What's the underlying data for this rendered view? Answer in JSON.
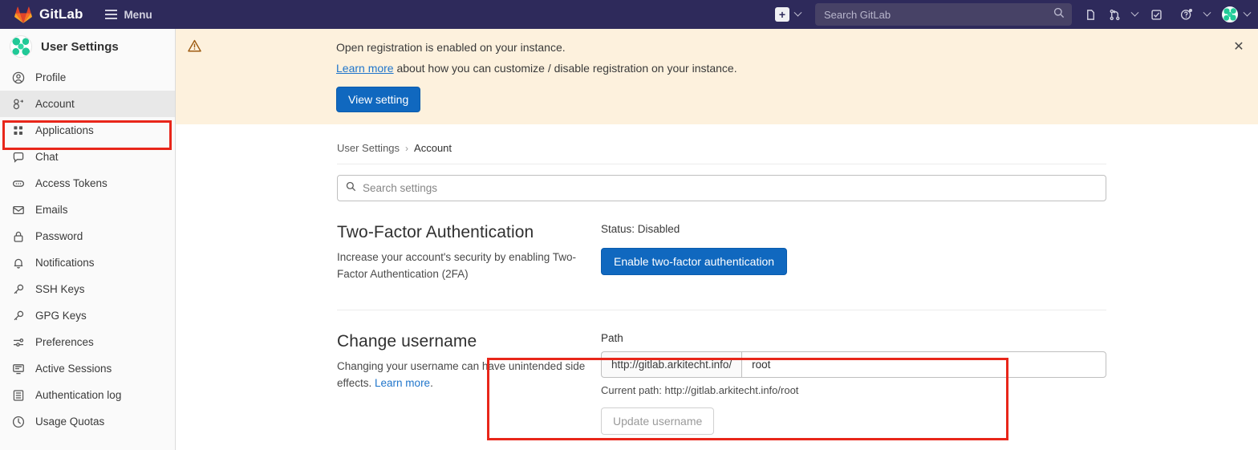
{
  "topbar": {
    "brand": "GitLab",
    "menu_label": "Menu",
    "plus_icon": "plus-icon",
    "plus_chevron_icon": "chevron-down-icon",
    "search_placeholder": "Search GitLab",
    "search_icon": "search-icon",
    "issues_icon": "issues-icon",
    "merge_requests_icon": "merge-requests-icon",
    "merge_requests_chevron_icon": "chevron-down-icon",
    "todos_icon": "todos-checkbox-icon",
    "help_icon": "help-question-icon",
    "help_chevron_icon": "chevron-down-icon",
    "avatar_icon": "user-avatar",
    "avatar_chevron_icon": "chevron-down-icon"
  },
  "sidebar": {
    "title": "User Settings",
    "avatar_icon": "user-avatar",
    "items": [
      {
        "label": "Profile",
        "icon": "user-circle-icon",
        "active": false
      },
      {
        "label": "Account",
        "icon": "account-key-icon",
        "active": true
      },
      {
        "label": "Applications",
        "icon": "applications-icon",
        "active": false
      },
      {
        "label": "Chat",
        "icon": "chat-bubble-icon",
        "active": false
      },
      {
        "label": "Access Tokens",
        "icon": "token-icon",
        "active": false
      },
      {
        "label": "Emails",
        "icon": "envelope-icon",
        "active": false
      },
      {
        "label": "Password",
        "icon": "lock-icon",
        "active": false
      },
      {
        "label": "Notifications",
        "icon": "bell-icon",
        "active": false
      },
      {
        "label": "SSH Keys",
        "icon": "key-icon",
        "active": false
      },
      {
        "label": "GPG Keys",
        "icon": "key-icon",
        "active": false
      },
      {
        "label": "Preferences",
        "icon": "sliders-icon",
        "active": false
      },
      {
        "label": "Active Sessions",
        "icon": "monitor-icon",
        "active": false
      },
      {
        "label": "Authentication log",
        "icon": "log-list-icon",
        "active": false
      },
      {
        "label": "Usage Quotas",
        "icon": "gauge-icon",
        "active": false
      }
    ]
  },
  "alert": {
    "warning_icon": "warning-triangle-icon",
    "line1": "Open registration is enabled on your instance.",
    "link_text": "Learn more",
    "line2_rest": " about how you can customize / disable registration on your instance.",
    "button_label": "View setting",
    "close_icon": "close-icon"
  },
  "breadcrumb": {
    "root": "User Settings",
    "separator": "›",
    "current": "Account"
  },
  "search_settings": {
    "placeholder": "Search settings",
    "icon": "search-icon",
    "value": ""
  },
  "two_factor": {
    "heading": "Two-Factor Authentication",
    "description": "Increase your account's security by enabling Two-Factor Authentication (2FA)",
    "status_label": "Status: Disabled",
    "button_label": "Enable two-factor authentication"
  },
  "change_username": {
    "heading": "Change username",
    "description_before": "Changing your username can have unintended side effects. ",
    "link_text": "Learn more",
    "description_after": ".",
    "path_label": "Path",
    "url_prefix": "http://gitlab.arkitecht.info/",
    "username_value": "root",
    "current_path": "Current path: http://gitlab.arkitecht.info/root",
    "update_button_label": "Update username"
  },
  "highlight_color": "#e8261a",
  "accent_color": "#1068bf",
  "brand_color": "#2e2a5b"
}
